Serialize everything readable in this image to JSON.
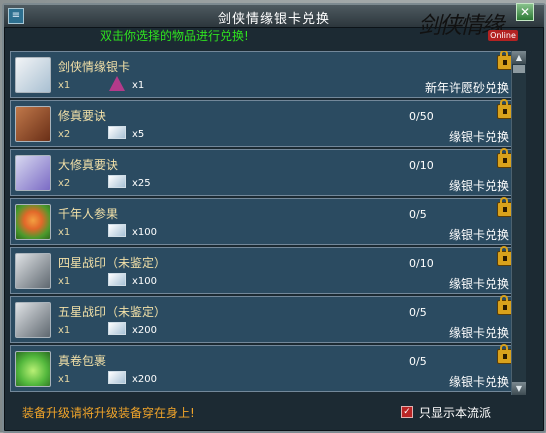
{
  "window": {
    "title": "剑侠情缘银卡兑换",
    "logo_text": "剑侠情缘",
    "logo_badge": "Online",
    "close_label": "✕"
  },
  "instruction": "双击你选择的物品进行兑换!",
  "items": [
    {
      "name": "剑侠情缘银卡",
      "qty": "x1",
      "cost_qty": "x1",
      "limit": "",
      "exchange": "新年许愿砂兑换",
      "icon": "silver-card-icon",
      "cost_icon": "wish-sand-icon"
    },
    {
      "name": "修真要诀",
      "qty": "x2",
      "cost_qty": "x5",
      "limit": "0/50",
      "exchange": "缘银卡兑换",
      "icon": "book-icon",
      "cost_icon": "silver-card-icon"
    },
    {
      "name": "大修真要诀",
      "qty": "x2",
      "cost_qty": "x25",
      "limit": "0/10",
      "exchange": "缘银卡兑换",
      "icon": "scroll-icon",
      "cost_icon": "silver-card-icon"
    },
    {
      "name": "千年人参果",
      "qty": "x1",
      "cost_qty": "x100",
      "limit": "0/5",
      "exchange": "缘银卡兑换",
      "icon": "ginseng-fruit-icon",
      "cost_icon": "silver-card-icon"
    },
    {
      "name": "四星战印（未鉴定）",
      "qty": "x1",
      "cost_qty": "x100",
      "limit": "0/10",
      "exchange": "缘银卡兑换",
      "icon": "war-seal-icon",
      "cost_icon": "silver-card-icon"
    },
    {
      "name": "五星战印（未鉴定）",
      "qty": "x1",
      "cost_qty": "x200",
      "limit": "0/5",
      "exchange": "缘银卡兑换",
      "icon": "war-seal-icon",
      "cost_icon": "silver-card-icon"
    },
    {
      "name": "真卷包裹",
      "qty": "x1",
      "cost_qty": "x200",
      "limit": "0/5",
      "exchange": "缘银卡兑换",
      "icon": "bag-icon",
      "cost_icon": "silver-card-icon"
    }
  ],
  "footer": {
    "hint": "装备升级请将升级装备穿在身上!",
    "checkbox_label": "只显示本流派",
    "checkbox_checked": true
  },
  "colors": {
    "instruction": "#2fe31f",
    "hint": "#f0a42a",
    "item_name": "#f2e0a8",
    "row_bg": "#2b4b61"
  }
}
